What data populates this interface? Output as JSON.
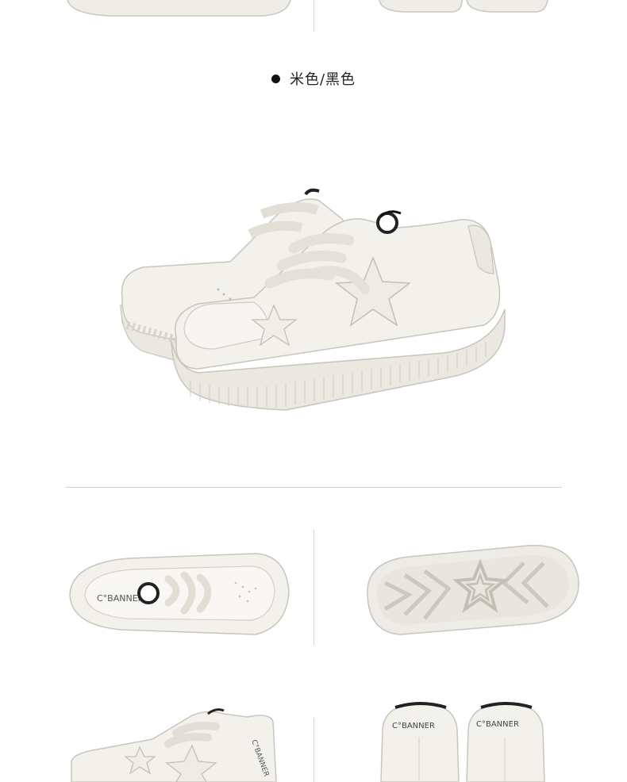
{
  "color_option": {
    "label": "米色/黑色"
  },
  "brand_marks": {
    "top_view": "C°BANNER",
    "heel_left": "C°BANNER",
    "heel_right": "C°BANNER",
    "side_heel": "C°BANNER"
  },
  "colors": {
    "shoe_body": "#f1efe9",
    "shoe_shadow": "#e2dfd7",
    "sole": "#ebe8e1",
    "outline": "#c9c5bb",
    "divider": "#d6d6d6",
    "accent_black": "#111111"
  }
}
